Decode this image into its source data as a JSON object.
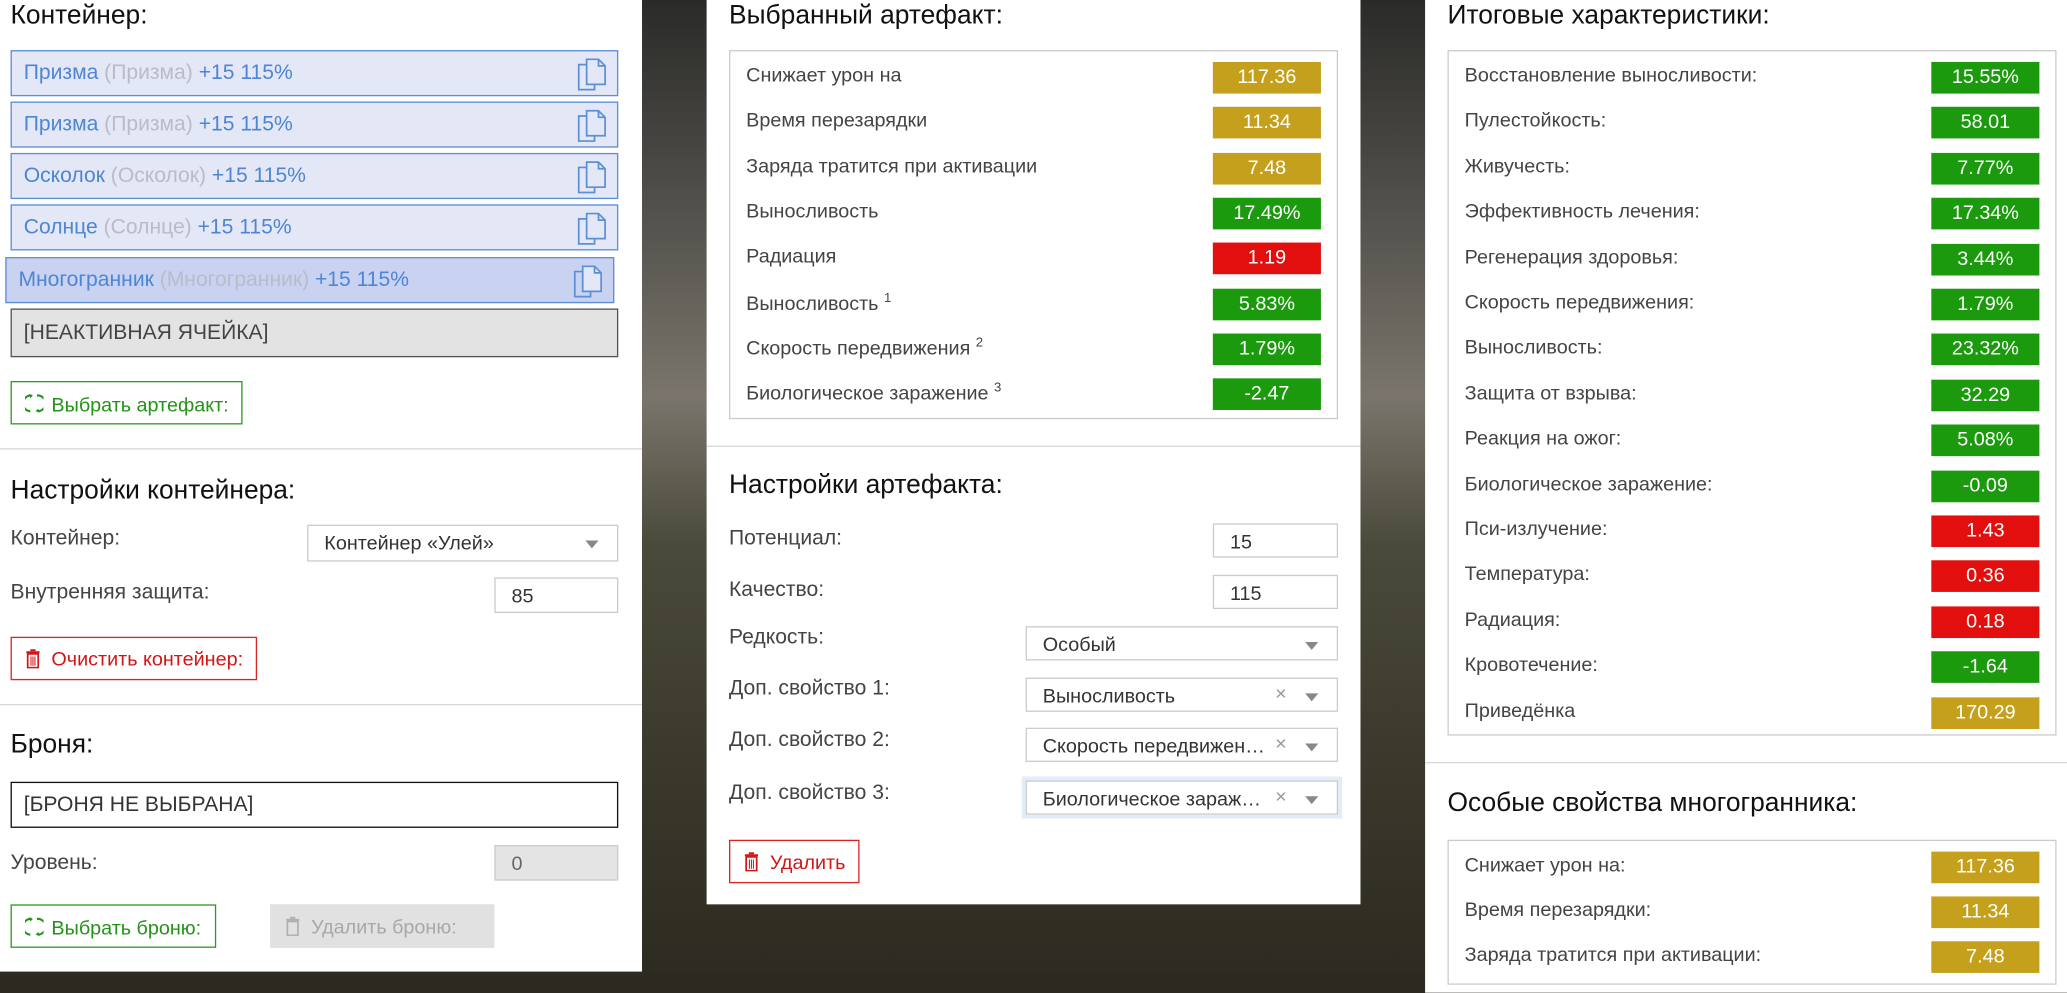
{
  "colors": {
    "gold": "#c5a01c",
    "green": "#1c9a0e",
    "red": "#e30f0f"
  },
  "container": {
    "title": "Контейнер:",
    "slots": [
      {
        "name": "Призма",
        "original": "(Призма)",
        "stats": "+15 115%",
        "selected": false
      },
      {
        "name": "Призма",
        "original": "(Призма)",
        "stats": "+15 115%",
        "selected": false
      },
      {
        "name": "Осколок",
        "original": "(Осколок)",
        "stats": "+15 115%",
        "selected": false
      },
      {
        "name": "Солнце",
        "original": "(Солнце)",
        "stats": "+15 115%",
        "selected": false
      },
      {
        "name": "Многогранник",
        "original": "(Многогранник)",
        "stats": "+15 115%",
        "selected": true
      }
    ],
    "inactive_slot": "[НЕАКТИВНАЯ ЯЧЕЙКА]",
    "choose_artifact_label": "Выбрать артефакт:"
  },
  "container_settings": {
    "title": "Настройки контейнера:",
    "container_label": "Контейнер:",
    "container_value": "Контейнер «Улей»",
    "inner_protection_label": "Внутренняя защита:",
    "inner_protection_value": "85",
    "clear_label": "Очистить контейнер:"
  },
  "armor": {
    "title": "Броня:",
    "value": "[БРОНЯ НЕ ВЫБРАНА]",
    "level_label": "Уровень:",
    "level_value": "0",
    "choose_label": "Выбрать броню:",
    "delete_label": "Удалить броню:"
  },
  "selected_artifact": {
    "title": "Выбранный артефакт:",
    "stats": [
      {
        "name": "Снижает урон на",
        "sup": "",
        "value": "117.36",
        "color": "gold"
      },
      {
        "name": "Время перезарядки",
        "sup": "",
        "value": "11.34",
        "color": "gold"
      },
      {
        "name": "Заряда тратится при активации",
        "sup": "",
        "value": "7.48",
        "color": "gold"
      },
      {
        "name": "Выносливость",
        "sup": "",
        "value": "17.49%",
        "color": "green"
      },
      {
        "name": "Радиация",
        "sup": "",
        "value": "1.19",
        "color": "red"
      },
      {
        "name": "Выносливость",
        "sup": "1",
        "value": "5.83%",
        "color": "green"
      },
      {
        "name": "Скорость передвижения",
        "sup": "2",
        "value": "1.79%",
        "color": "green"
      },
      {
        "name": "Биологическое заражение",
        "sup": "3",
        "value": "-2.47",
        "color": "green"
      }
    ]
  },
  "artifact_settings": {
    "title": "Настройки артефакта:",
    "potential_label": "Потенциал:",
    "potential_value": "15",
    "quality_label": "Качество:",
    "quality_value": "115",
    "rarity_label": "Редкость:",
    "rarity_value": "Особый",
    "extra1_label": "Доп. свойство 1:",
    "extra1_value": "Выносливость",
    "extra2_label": "Доп. свойство 2:",
    "extra2_value": "Скорость передвижения",
    "extra3_label": "Доп. свойство 3:",
    "extra3_value": "Биологическое заражение",
    "clear_symbol": "×",
    "delete_label": "Удалить"
  },
  "totals": {
    "title": "Итоговые характеристики:",
    "stats": [
      {
        "name": "Восстановление выносливости:",
        "value": "15.55%",
        "color": "green"
      },
      {
        "name": "Пулестойкость:",
        "value": "58.01",
        "color": "green"
      },
      {
        "name": "Живучесть:",
        "value": "7.77%",
        "color": "green"
      },
      {
        "name": "Эффективность лечения:",
        "value": "17.34%",
        "color": "green"
      },
      {
        "name": "Регенерация здоровья:",
        "value": "3.44%",
        "color": "green"
      },
      {
        "name": "Скорость передвижения:",
        "value": "1.79%",
        "color": "green"
      },
      {
        "name": "Выносливость:",
        "value": "23.32%",
        "color": "green"
      },
      {
        "name": "Защита от взрыва:",
        "value": "32.29",
        "color": "green"
      },
      {
        "name": "Реакция на ожог:",
        "value": "5.08%",
        "color": "green"
      },
      {
        "name": "Биологическое заражение:",
        "value": "-0.09",
        "color": "green"
      },
      {
        "name": "Пси-излучение:",
        "value": "1.43",
        "color": "red"
      },
      {
        "name": "Температура:",
        "value": "0.36",
        "color": "red"
      },
      {
        "name": "Радиация:",
        "value": "0.18",
        "color": "red"
      },
      {
        "name": "Кровотечение:",
        "value": "-1.64",
        "color": "green"
      },
      {
        "name": "Приведёнка",
        "value": "170.29",
        "color": "gold"
      }
    ]
  },
  "special": {
    "title": "Особые свойства многогранника:",
    "stats": [
      {
        "name": "Снижает урон на:",
        "value": "117.36",
        "color": "gold"
      },
      {
        "name": "Время перезарядки:",
        "value": "11.34",
        "color": "gold"
      },
      {
        "name": "Заряда тратится при активации:",
        "value": "7.48",
        "color": "gold"
      }
    ]
  }
}
